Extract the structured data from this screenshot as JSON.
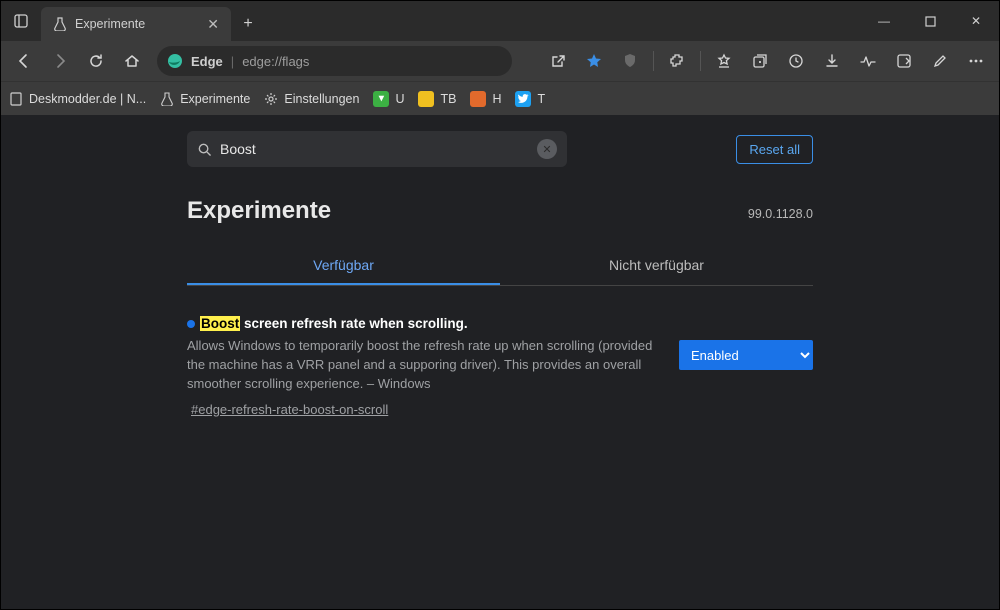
{
  "window": {
    "tab_title": "Experimente",
    "minimize": "—",
    "maximize": "▢",
    "close": "✕"
  },
  "toolbar": {
    "edge_label": "Edge",
    "url": "edge://flags"
  },
  "bookmarks": {
    "items": [
      {
        "label": "Deskmodder.de | N..."
      },
      {
        "label": "Experimente"
      },
      {
        "label": "Einstellungen"
      },
      {
        "label": "U"
      },
      {
        "label": "TB"
      },
      {
        "label": "H"
      },
      {
        "label": "T"
      }
    ]
  },
  "search": {
    "value": "Boost"
  },
  "actions": {
    "reset_all": "Reset all"
  },
  "header": {
    "title": "Experimente",
    "version": "99.0.1128.0"
  },
  "tabs": {
    "available": "Verfügbar",
    "unavailable": "Nicht verfügbar"
  },
  "flag": {
    "highlight": "Boost",
    "title_rest": " screen refresh rate when scrolling.",
    "description": "Allows Windows to temporarily boost the refresh rate up when scrolling (provided the machine has a VRR panel and a supporing driver). This provides an overall smoother scrolling experience. – Windows",
    "hash": "#edge-refresh-rate-boost-on-scroll",
    "selected": "Enabled"
  }
}
